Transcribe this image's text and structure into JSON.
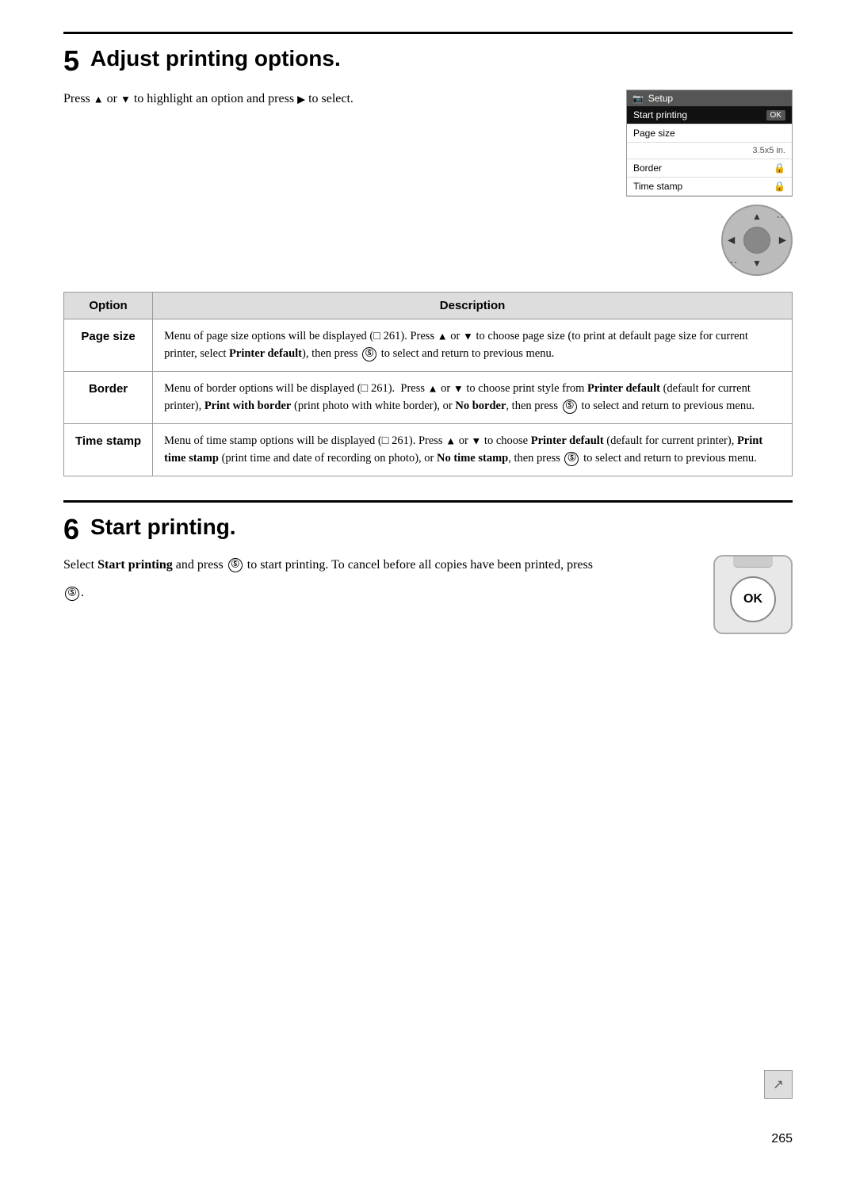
{
  "page": {
    "number": "265"
  },
  "step5": {
    "number": "5",
    "title": "Adjust printing options.",
    "intro": "Press ▲ or ▼ to highlight an option and press ▶ to select.",
    "setup_screen": {
      "title": "Setup",
      "rows": [
        {
          "label": "Start printing",
          "value": "OK",
          "type": "highlighted"
        },
        {
          "label": "Page size",
          "value": "",
          "type": "normal"
        },
        {
          "label": "",
          "value": "3.5x5 in.",
          "type": "sub"
        },
        {
          "label": "Border",
          "value": "🔒",
          "type": "normal"
        },
        {
          "label": "Time stamp",
          "value": "🔒",
          "type": "normal"
        }
      ]
    },
    "table": {
      "col_option": "Option",
      "col_description": "Description",
      "rows": [
        {
          "option": "Page size",
          "description_parts": [
            {
              "text": "Menu of page size options will be displayed (",
              "type": "normal"
            },
            {
              "text": "0",
              "type": "ref"
            },
            {
              "text": "261).",
              "type": "normal"
            },
            {
              "text": " Press ▲ or ▼ to choose page size (to print at default page size for current printer, select ",
              "type": "normal"
            },
            {
              "text": "Printer default",
              "type": "bold"
            },
            {
              "text": "), then press ",
              "type": "normal"
            },
            {
              "text": "OK",
              "type": "circle"
            },
            {
              "text": " to select and return to previous menu.",
              "type": "normal"
            }
          ]
        },
        {
          "option": "Border",
          "description_parts": [
            {
              "text": "Menu of border options will be displayed (",
              "type": "normal"
            },
            {
              "text": "0",
              "type": "ref"
            },
            {
              "text": "261).  Press ▲ or ▼ to choose print style from ",
              "type": "normal"
            },
            {
              "text": "Printer default",
              "type": "bold"
            },
            {
              "text": " (default for current printer), ",
              "type": "normal"
            },
            {
              "text": "Print with border",
              "type": "bold"
            },
            {
              "text": " (print photo with white border), or ",
              "type": "normal"
            },
            {
              "text": "No border",
              "type": "bold"
            },
            {
              "text": ", then press ",
              "type": "normal"
            },
            {
              "text": "OK",
              "type": "circle"
            },
            {
              "text": " to select and return to previous menu.",
              "type": "normal"
            }
          ]
        },
        {
          "option": "Time stamp",
          "description_parts": [
            {
              "text": "Menu of time stamp options will be displayed (",
              "type": "normal"
            },
            {
              "text": "0",
              "type": "ref"
            },
            {
              "text": "261). Press ▲ or ▼ to choose ",
              "type": "normal"
            },
            {
              "text": "Printer default",
              "type": "bold"
            },
            {
              "text": " (default for current printer), ",
              "type": "normal"
            },
            {
              "text": "Print time stamp",
              "type": "bold"
            },
            {
              "text": " (print time and date of recording on photo), or ",
              "type": "normal"
            },
            {
              "text": "No time stamp",
              "type": "bold"
            },
            {
              "text": ", then press ",
              "type": "normal"
            },
            {
              "text": "OK",
              "type": "circle"
            },
            {
              "text": " to select and return to previous menu.",
              "type": "normal"
            }
          ]
        }
      ]
    }
  },
  "step6": {
    "number": "6",
    "title": "Start printing.",
    "text1": "Select ",
    "text1_bold": "Start printing",
    "text2": " and press ",
    "text3": " to start printing.",
    "text4": "To cancel before all copies have been printed, press ",
    "text5": "."
  }
}
